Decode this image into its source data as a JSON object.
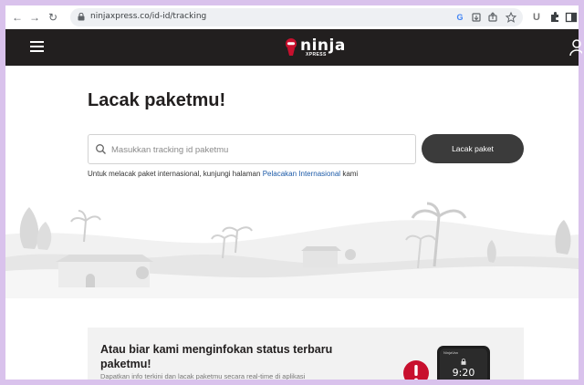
{
  "browser": {
    "url": "ninjaxpress.co/id-id/tracking",
    "back_icon": "←",
    "forward_icon": "→",
    "reload_icon": "↻"
  },
  "header": {
    "logo_word": "ninja",
    "logo_sub": "XPRESS",
    "brand_color": "#221f1f",
    "logo_accent": "#c8102e"
  },
  "tracking": {
    "title": "Lacak paketmu!",
    "placeholder": "Masukkan tracking id paketmu",
    "button_label": "Lacak paket",
    "note_prefix": "Untuk melacak paket internasional, kunjungi halaman",
    "note_link": "Pelacakan Internasional",
    "note_suffix": "kami"
  },
  "promo": {
    "title": "Atau biar kami menginfokan status terbaru paketmu!",
    "subtitle": "Dapatkan info terkini dan lacak paketmu secara real-time di aplikasi",
    "phone_brand": "NinjaVan",
    "phone_time": "9:20",
    "alert_color": "#c8102e"
  }
}
